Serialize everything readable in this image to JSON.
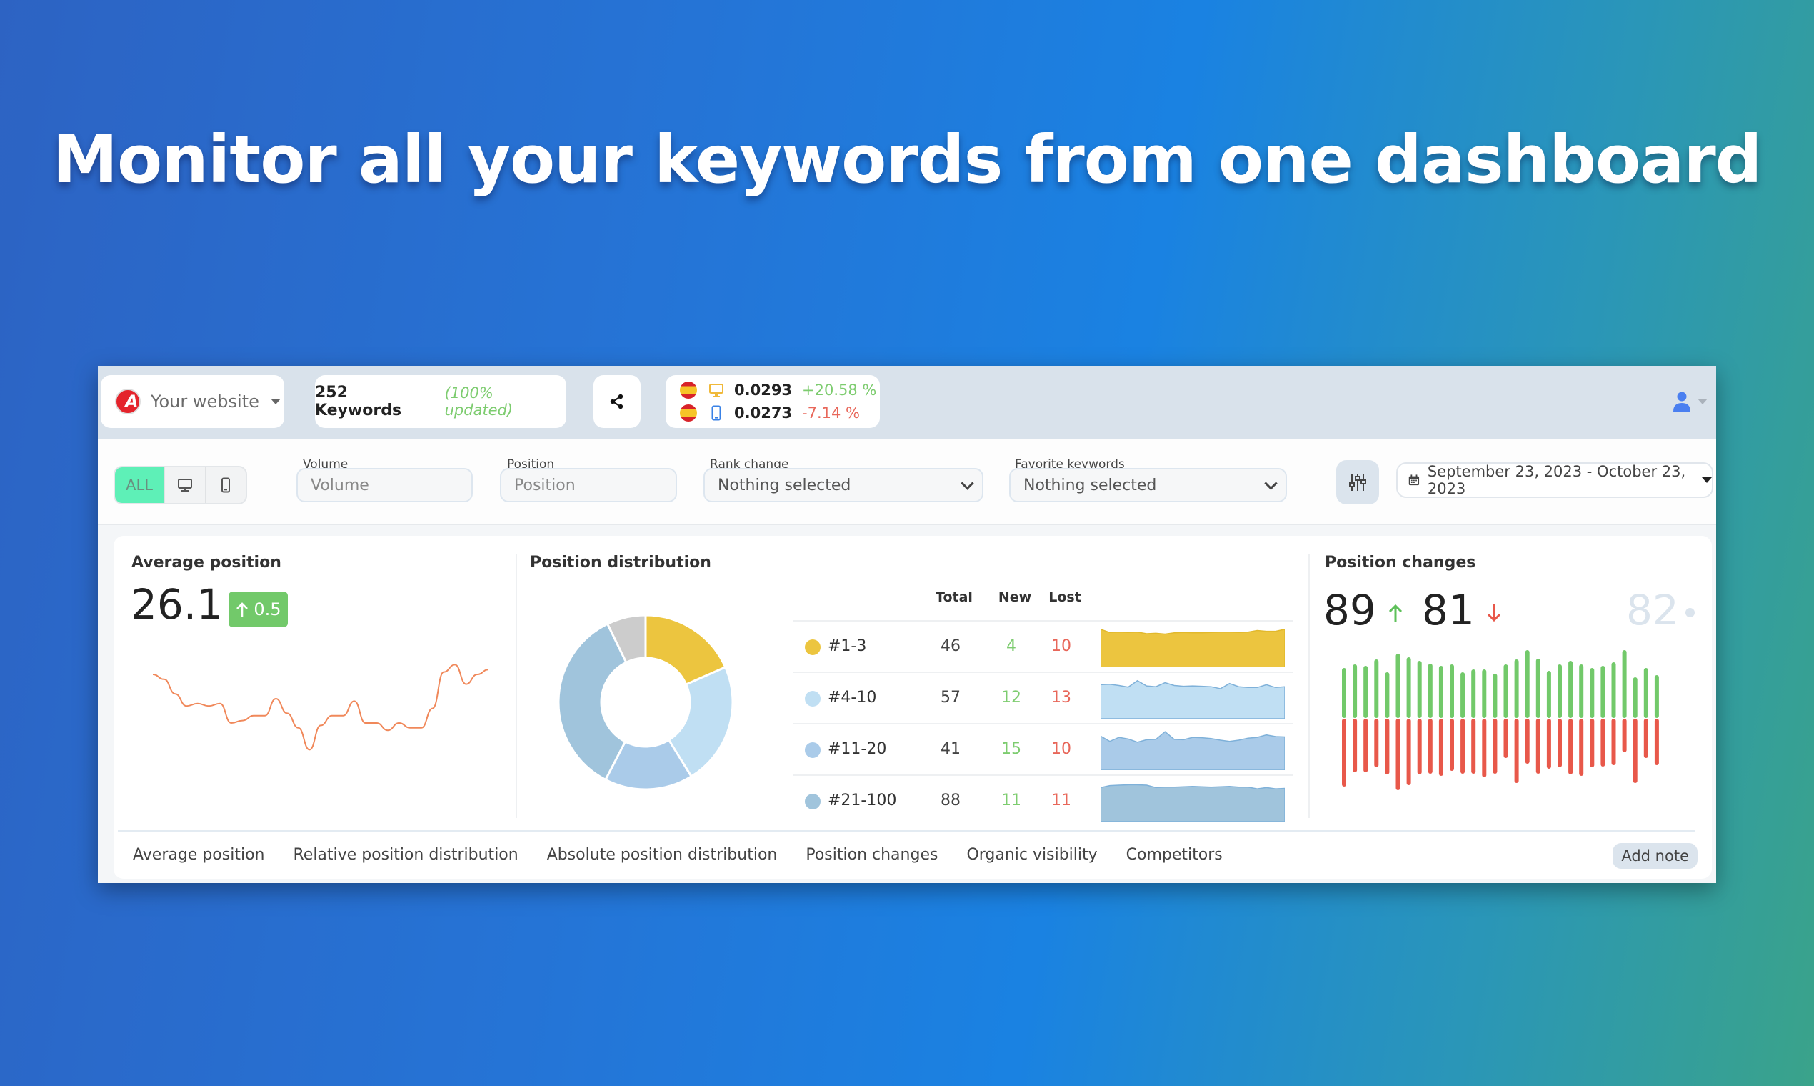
{
  "hero": {
    "title": "Monitor all your keywords from one dashboard"
  },
  "topbar": {
    "website": {
      "label": "Your website",
      "logo_letter": "A"
    },
    "keywords": {
      "count_label": "252 Keywords",
      "status": "(100% updated)"
    },
    "share_icon": "share-icon",
    "visibility": [
      {
        "device": "desktop",
        "value": "0.0293",
        "change": "+20.58 %",
        "trend": "up"
      },
      {
        "device": "mobile",
        "value": "0.0273",
        "change": "-7.14 %",
        "trend": "down"
      }
    ],
    "user_icon": "user-icon"
  },
  "filters": {
    "device_toggle": {
      "all_label": "ALL",
      "selected": "ALL",
      "options": [
        "ALL",
        "desktop",
        "mobile"
      ]
    },
    "volume": {
      "label": "Volume",
      "placeholder": "Volume"
    },
    "position": {
      "label": "Position",
      "placeholder": "Position"
    },
    "rank_change": {
      "label": "Rank change",
      "value": "Nothing selected"
    },
    "favorite": {
      "label": "Favorite keywords",
      "value": "Nothing selected"
    },
    "date_range": "September 23, 2023 - October 23, 2023"
  },
  "average_position": {
    "title": "Average position",
    "value": "26.1",
    "change": "0.5",
    "change_dir": "up"
  },
  "position_distribution": {
    "title": "Position distribution",
    "headers": {
      "total": "Total",
      "new": "New",
      "lost": "Lost"
    },
    "rows": [
      {
        "label": "#1-3",
        "total": "46",
        "new": "4",
        "lost": "10",
        "color": "#ecc53f"
      },
      {
        "label": "#4-10",
        "total": "57",
        "new": "12",
        "lost": "13",
        "color": "#c0dff3"
      },
      {
        "label": "#11-20",
        "total": "41",
        "new": "15",
        "lost": "10",
        "color": "#aacbe9"
      },
      {
        "label": "#21-100",
        "total": "88",
        "new": "11",
        "lost": "11",
        "color": "#a0c4dc"
      }
    ]
  },
  "position_changes": {
    "title": "Position changes",
    "up": "89",
    "down": "81",
    "unchanged": "82"
  },
  "bottom_tabs": [
    "Average position",
    "Relative position distribution",
    "Absolute position distribution",
    "Position changes",
    "Organic visibility",
    "Competitors"
  ],
  "add_note": "Add note",
  "chart_data": [
    {
      "type": "line",
      "title": "Average position",
      "series": [
        {
          "name": "Average position",
          "color": "#f0885a",
          "values": [
            27.0,
            26.8,
            26.2,
            25.7,
            25.8,
            25.7,
            25.8,
            25.0,
            25.1,
            25.3,
            25.3,
            26.0,
            25.4,
            24.8,
            23.9,
            24.9,
            25.3,
            25.3,
            25.9,
            25.0,
            25.0,
            24.7,
            25.0,
            24.8,
            24.8,
            25.6,
            27.1,
            27.4,
            26.6,
            27.0,
            27.2
          ]
        }
      ],
      "ylim": [
        23,
        28
      ],
      "grid": false
    },
    {
      "type": "pie",
      "title": "Position distribution",
      "categories": [
        "#1-3",
        "#4-10",
        "#11-20",
        "#21-100",
        "other"
      ],
      "values": [
        46,
        57,
        41,
        88,
        18
      ],
      "colors": [
        "#ecc53f",
        "#c0dff3",
        "#aacbe9",
        "#a0c4dc",
        "#cccccc"
      ]
    },
    {
      "type": "area",
      "title": "Position distribution trends",
      "series": [
        {
          "name": "#1-3",
          "color": "#ecc53f",
          "values": [
            0.95,
            0.87,
            0.88,
            0.87,
            0.88,
            0.84,
            0.85,
            0.83,
            0.86,
            0.87,
            0.86,
            0.86,
            0.87,
            0.88,
            0.88,
            0.87,
            0.88,
            0.92,
            0.9,
            0.9,
            0.95
          ]
        },
        {
          "name": "#4-10",
          "color": "#c0dff3",
          "values": [
            0.85,
            0.86,
            0.83,
            0.79,
            0.95,
            0.82,
            0.8,
            0.9,
            0.83,
            0.81,
            0.82,
            0.81,
            0.8,
            0.75,
            0.88,
            0.8,
            0.78,
            0.78,
            0.85,
            0.78,
            0.8
          ]
        },
        {
          "name": "#11-20",
          "color": "#aacbe9",
          "values": [
            0.85,
            0.72,
            0.82,
            0.78,
            0.7,
            0.76,
            0.77,
            0.96,
            0.77,
            0.76,
            0.82,
            0.81,
            0.79,
            0.75,
            0.72,
            0.75,
            0.8,
            0.82,
            0.88,
            0.84,
            0.83
          ]
        },
        {
          "name": "#21-100",
          "color": "#a0c4dc",
          "values": [
            0.85,
            0.9,
            0.91,
            0.92,
            0.92,
            0.91,
            0.85,
            0.86,
            0.86,
            0.87,
            0.88,
            0.87,
            0.86,
            0.87,
            0.88,
            0.86,
            0.86,
            0.82,
            0.85,
            0.82,
            0.83
          ]
        }
      ],
      "ylim": [
        0,
        1
      ]
    },
    {
      "type": "bar",
      "title": "Position changes",
      "series": [
        {
          "name": "improved",
          "color": "#72c96a",
          "values": [
            70,
            75,
            73,
            82,
            64,
            90,
            85,
            80,
            76,
            73,
            75,
            64,
            68,
            68,
            62,
            75,
            82,
            95,
            83,
            66,
            75,
            80,
            75,
            70,
            73,
            78,
            95,
            57,
            70,
            60
          ]
        },
        {
          "name": "declined",
          "color": "#e8584a",
          "values": [
            95,
            75,
            75,
            68,
            78,
            100,
            93,
            78,
            77,
            80,
            73,
            77,
            77,
            82,
            77,
            55,
            90,
            63,
            77,
            70,
            68,
            78,
            80,
            68,
            67,
            65,
            47,
            90,
            55,
            65
          ]
        }
      ]
    }
  ]
}
